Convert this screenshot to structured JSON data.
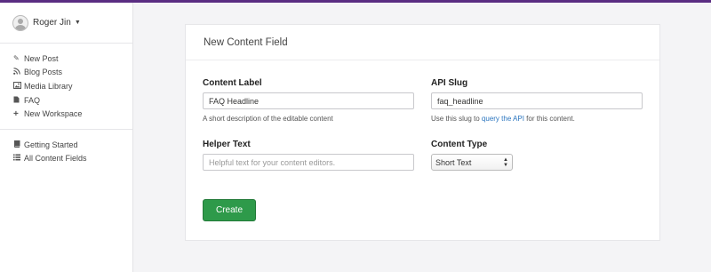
{
  "user": {
    "name": "Roger Jin"
  },
  "sidebar": {
    "primary": [
      {
        "label": "New Post",
        "icon": "pencil-icon"
      },
      {
        "label": "Blog Posts",
        "icon": "rss-icon"
      },
      {
        "label": "Media Library",
        "icon": "image-icon"
      },
      {
        "label": "FAQ",
        "icon": "document-icon"
      },
      {
        "label": "New Workspace",
        "icon": "plus-icon"
      }
    ],
    "secondary": [
      {
        "label": "Getting Started",
        "icon": "book-icon"
      },
      {
        "label": "All Content Fields",
        "icon": "list-icon"
      }
    ]
  },
  "card": {
    "title": "New Content Field",
    "content_label": {
      "label": "Content Label",
      "value": "FAQ Headline",
      "help": "A short description of the editable content"
    },
    "api_slug": {
      "label": "API Slug",
      "value": "faq_headline",
      "help_prefix": "Use this slug to ",
      "help_link": "query the API",
      "help_suffix": " for this content."
    },
    "helper_text": {
      "label": "Helper Text",
      "placeholder": "Helpful text for your content editors."
    },
    "content_type": {
      "label": "Content Type",
      "selected": "Short Text"
    },
    "create_label": "Create"
  },
  "colors": {
    "accent": "#5a2d82",
    "primary_button": "#2e9a4a",
    "link": "#2a75bf"
  }
}
